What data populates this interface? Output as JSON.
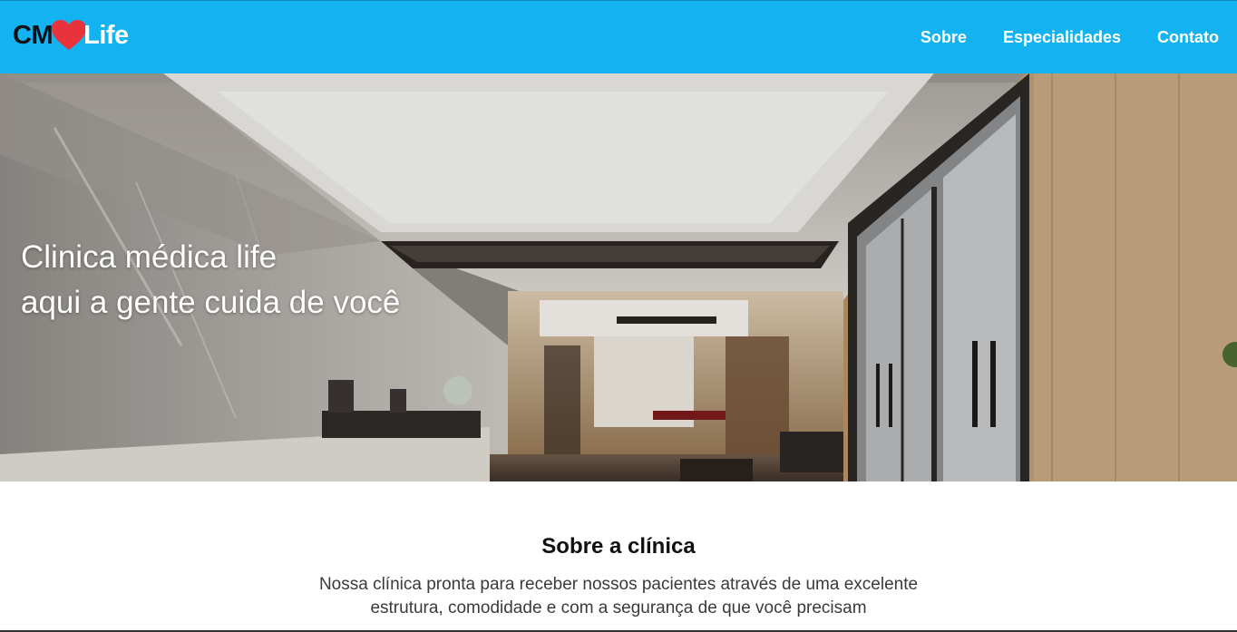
{
  "brand": {
    "prefix": "CM",
    "suffix": "Life",
    "heart_color": "#e8333c"
  },
  "nav": {
    "items": [
      {
        "label": "Sobre"
      },
      {
        "label": "Especialidades"
      },
      {
        "label": "Contato"
      }
    ]
  },
  "hero": {
    "line1": "Clinica médica life",
    "line2": "aqui a gente cuida de você"
  },
  "about": {
    "title": "Sobre a clínica",
    "text_line1": "Nossa clínica pronta para receber nossos pacientes através de uma excelente",
    "text_line2": "estrutura, comodidade e com a segurança de que você precisam"
  },
  "colors": {
    "header_bg": "#13b3f2",
    "header_text": "#ffffff"
  }
}
